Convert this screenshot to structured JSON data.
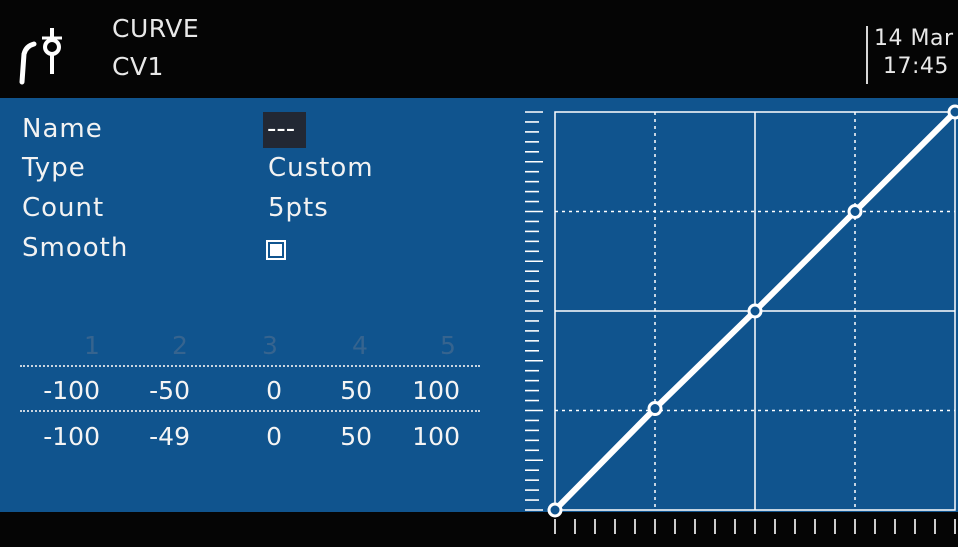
{
  "header": {
    "title": "CURVE",
    "subtitle": "CV1",
    "date": "14 Mar",
    "time": "17:45",
    "icon": "curve-icon",
    "background": "#050505"
  },
  "settings": {
    "name": {
      "label": "Name",
      "value": "---"
    },
    "type": {
      "label": "Type",
      "value": "Custom"
    },
    "count": {
      "label": "Count",
      "value": "5pts"
    },
    "smooth": {
      "label": "Smooth",
      "checked": true
    }
  },
  "points_table": {
    "point_numbers": [
      "1",
      "2",
      "3",
      "4",
      "5"
    ],
    "x_row": [
      "-100",
      "-50",
      "0",
      "50",
      "100"
    ],
    "y_row": [
      "-100",
      "-49",
      "0",
      "50",
      "100"
    ]
  },
  "curve": {
    "x_values": [
      -100,
      -50,
      0,
      50,
      100
    ],
    "y_values": [
      -100,
      -49,
      0,
      50,
      100
    ],
    "x_range": [
      -100,
      100
    ],
    "y_range": [
      -100,
      100
    ]
  },
  "colors": {
    "panel_blue": "#10548e",
    "curve_line": "#ffffff",
    "point_label_dim": "#36648f"
  }
}
